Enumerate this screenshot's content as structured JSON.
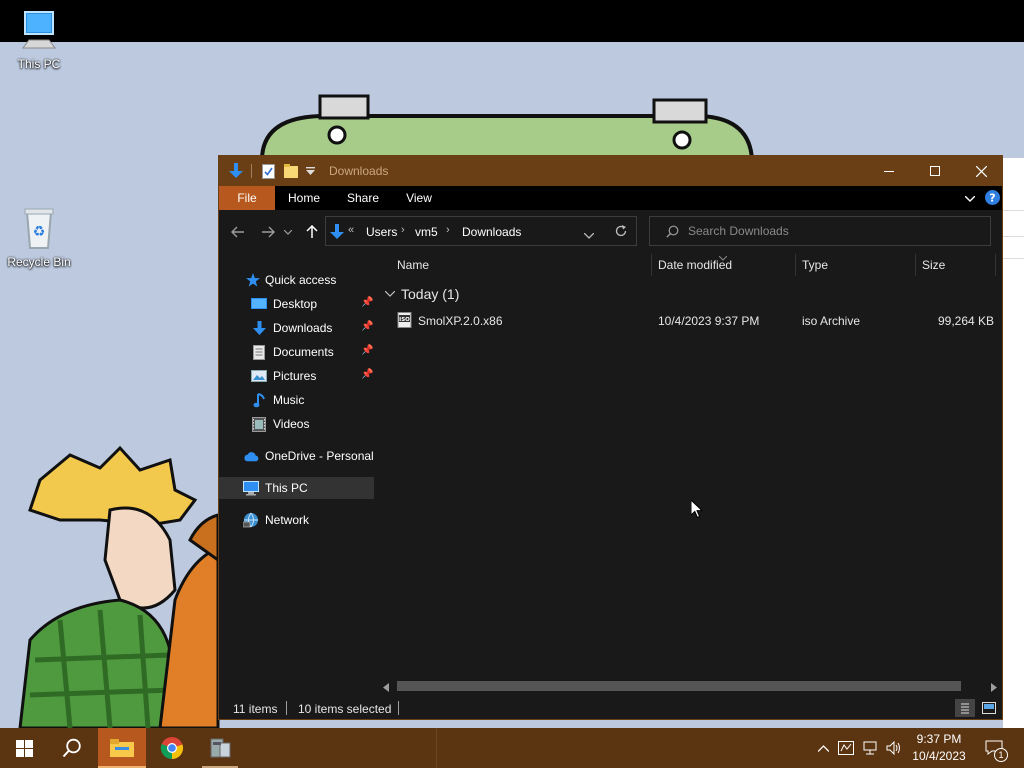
{
  "desktop": {
    "icons": [
      {
        "label": "This PC"
      },
      {
        "label": "Recycle Bin"
      }
    ]
  },
  "window": {
    "title": "Downloads",
    "controls": {
      "minimize": "─",
      "maximize": "☐",
      "close": "✕"
    }
  },
  "ribbon": {
    "tabs": [
      "File",
      "Home",
      "Share",
      "View"
    ]
  },
  "address": {
    "overflow": "«",
    "crumbs": [
      "Users",
      "vm5",
      "Downloads"
    ],
    "sep": "›"
  },
  "search": {
    "placeholder": "Search Downloads"
  },
  "nav": {
    "quick_access": "Quick access",
    "items": [
      {
        "label": "Desktop",
        "pinned": true
      },
      {
        "label": "Downloads",
        "pinned": true
      },
      {
        "label": "Documents",
        "pinned": true
      },
      {
        "label": "Pictures",
        "pinned": true
      },
      {
        "label": "Music",
        "pinned": false
      },
      {
        "label": "Videos",
        "pinned": false
      }
    ],
    "onedrive": "OneDrive - Personal",
    "this_pc": "This PC",
    "network": "Network"
  },
  "columns": [
    "Name",
    "Date modified",
    "Type",
    "Size"
  ],
  "groups": [
    {
      "label": "Today (1)",
      "files": [
        {
          "name": "SmolXP.2.0.x86",
          "date": "10/4/2023 9:37 PM",
          "type": "iso Archive",
          "size": "99,264 KB"
        }
      ]
    }
  ],
  "status": {
    "items": "11 items",
    "selected": "10 items selected"
  },
  "taskbar": {
    "time": "9:37 PM",
    "date": "10/4/2023",
    "notification_count": "1"
  },
  "colors": {
    "accent": "#6b3f15",
    "file_tab": "#b7591e",
    "taskbar": "#5b3411",
    "pane_bg": "#191919"
  }
}
